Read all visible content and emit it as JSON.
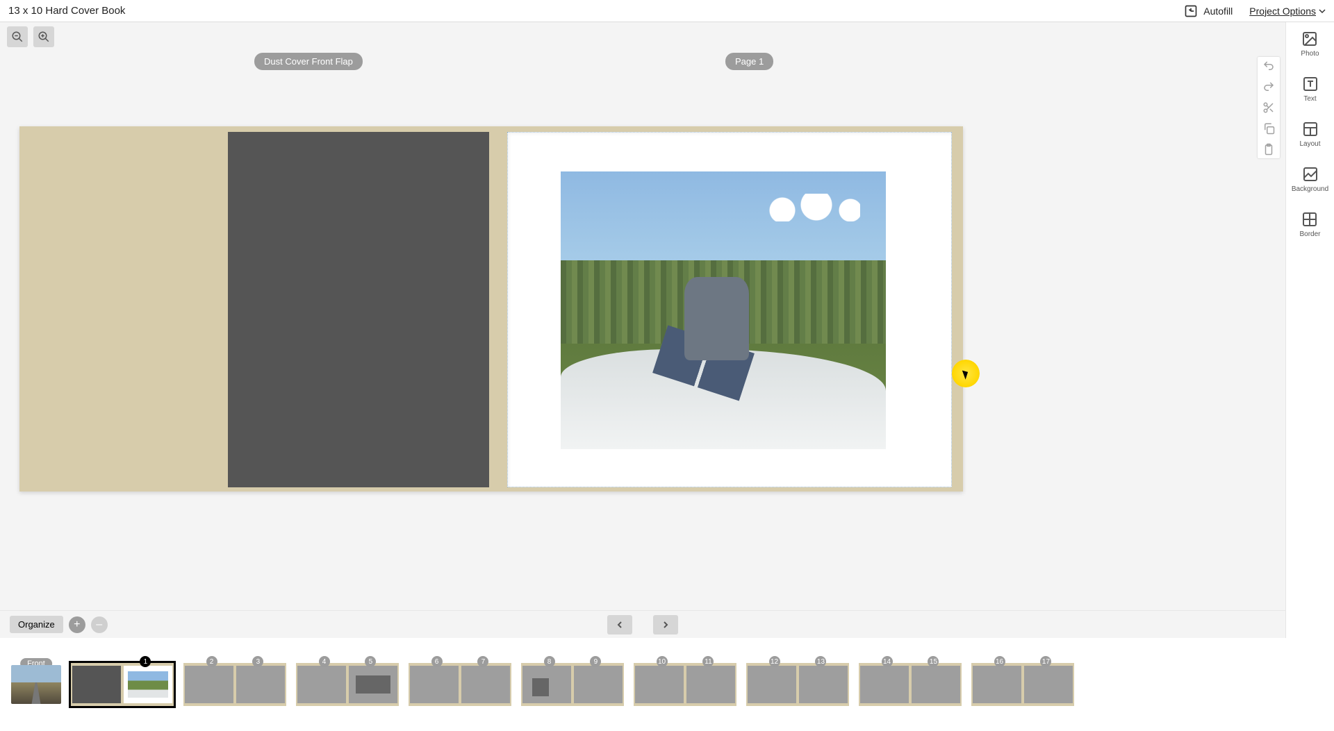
{
  "header": {
    "title": "13 x 10 Hard Cover Book",
    "autofill_label": "Autofill",
    "project_options_label": "Project Options"
  },
  "spread_labels": {
    "left": "Dust Cover Front Flap",
    "right": "Page 1"
  },
  "tools": {
    "photo": "Photo",
    "text": "Text",
    "layout": "Layout",
    "background": "Background",
    "border": "Border"
  },
  "bottom": {
    "organize": "Organize",
    "front_badge": "Front"
  },
  "thumbs": [
    {
      "l": "1",
      "r": null,
      "current": true,
      "cover": true
    },
    {
      "l": "2",
      "r": "3"
    },
    {
      "l": "4",
      "r": "5",
      "r_box": true
    },
    {
      "l": "6",
      "r": "7"
    },
    {
      "l": "8",
      "r": "9",
      "l_narrow_box": true
    },
    {
      "l": "10",
      "r": "11"
    },
    {
      "l": "12",
      "r": "13"
    },
    {
      "l": "14",
      "r": "15"
    },
    {
      "l": "16",
      "r": "17"
    }
  ],
  "colors": {
    "cover": "#d7ccab",
    "inside_cover": "#555555",
    "pill": "#9c9c9c"
  }
}
